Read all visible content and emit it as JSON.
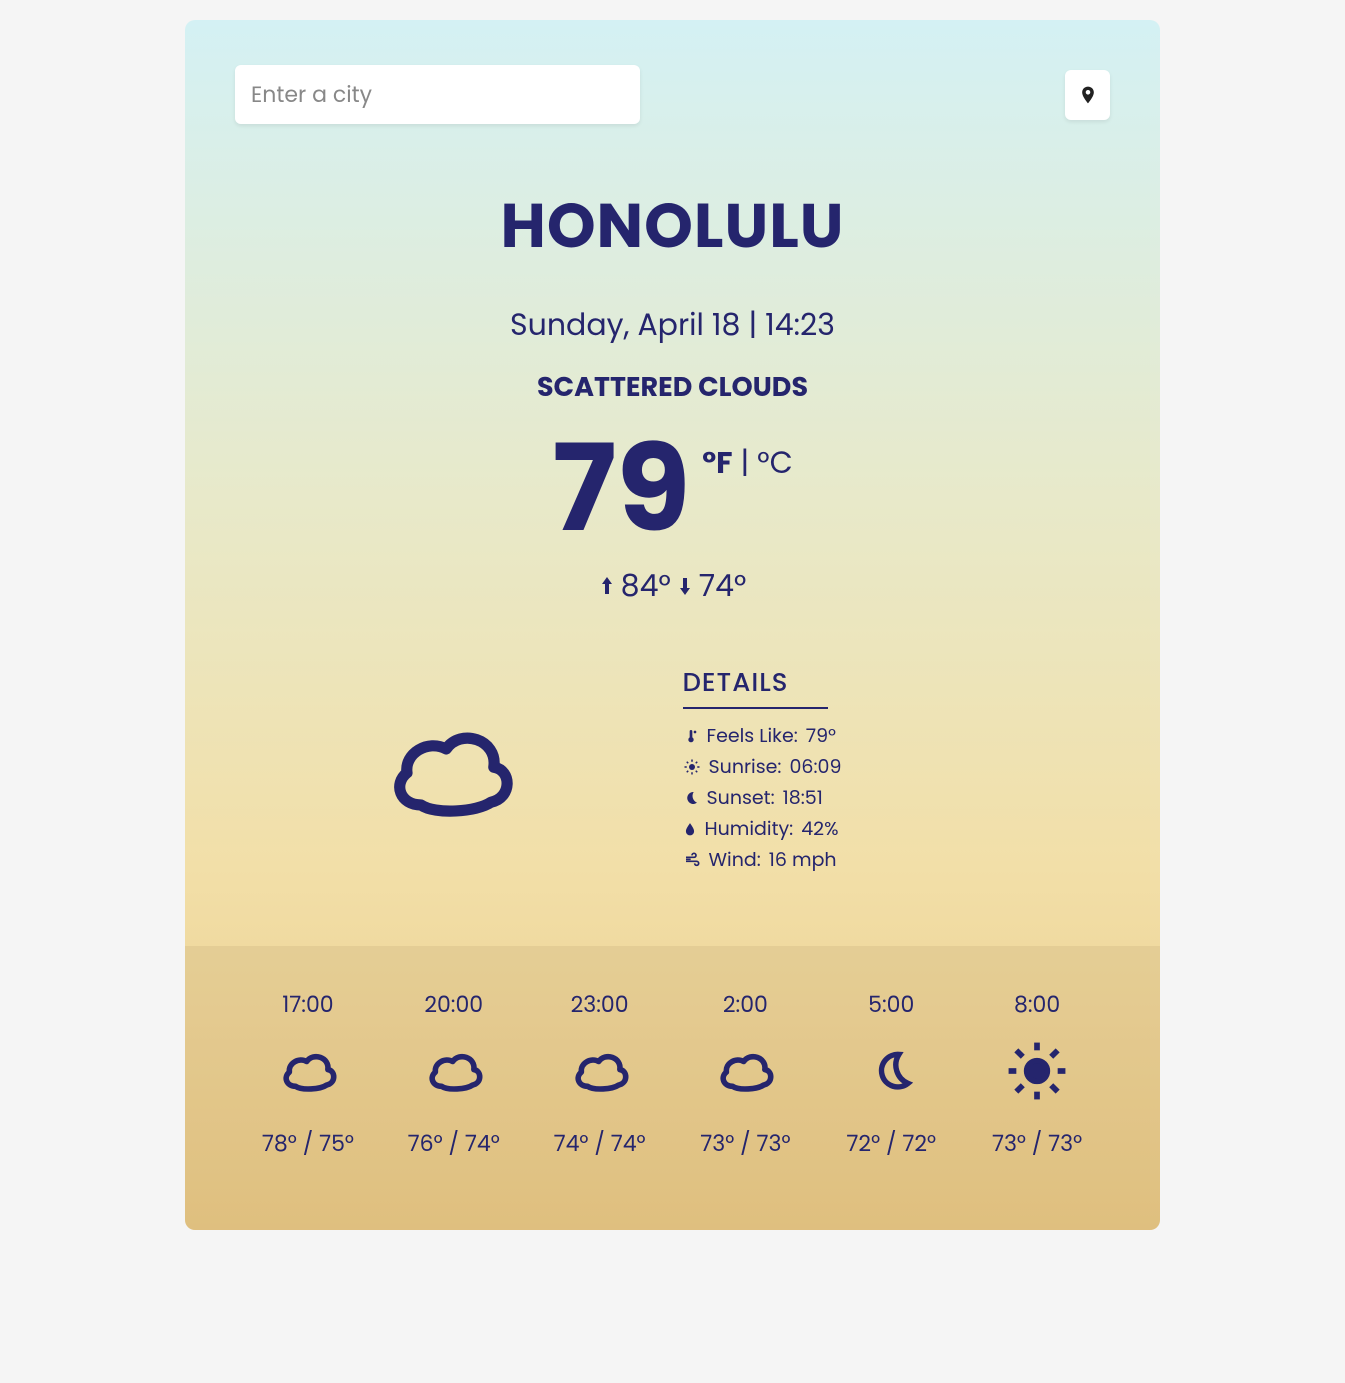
{
  "search": {
    "placeholder": "Enter a city"
  },
  "city": "HONOLULU",
  "datetime": "Sunday, April 18 | 14:23",
  "condition": "SCATTERED CLOUDS",
  "temperature": "79",
  "units": {
    "active": "°F",
    "separator": " | ",
    "inactive": "°C"
  },
  "high": "84°",
  "low": "74°",
  "details": {
    "title": "DETAILS",
    "feels_like_label": "Feels Like:",
    "feels_like_value": "79°",
    "sunrise_label": "Sunrise:",
    "sunrise_value": "06:09",
    "sunset_label": "Sunset:",
    "sunset_value": "18:51",
    "humidity_label": "Humidity:",
    "humidity_value": "42%",
    "wind_label": "Wind:",
    "wind_value": "16 mph"
  },
  "forecast": [
    {
      "time": "17:00",
      "icon": "cloud",
      "hi": "78°",
      "lo": "75°"
    },
    {
      "time": "20:00",
      "icon": "cloud",
      "hi": "76°",
      "lo": "74°"
    },
    {
      "time": "23:00",
      "icon": "cloud",
      "hi": "74°",
      "lo": "74°"
    },
    {
      "time": "2:00",
      "icon": "cloud",
      "hi": "73°",
      "lo": "73°"
    },
    {
      "time": "5:00",
      "icon": "moon",
      "hi": "72°",
      "lo": "72°"
    },
    {
      "time": "8:00",
      "icon": "sun",
      "hi": "73°",
      "lo": "73°"
    }
  ]
}
